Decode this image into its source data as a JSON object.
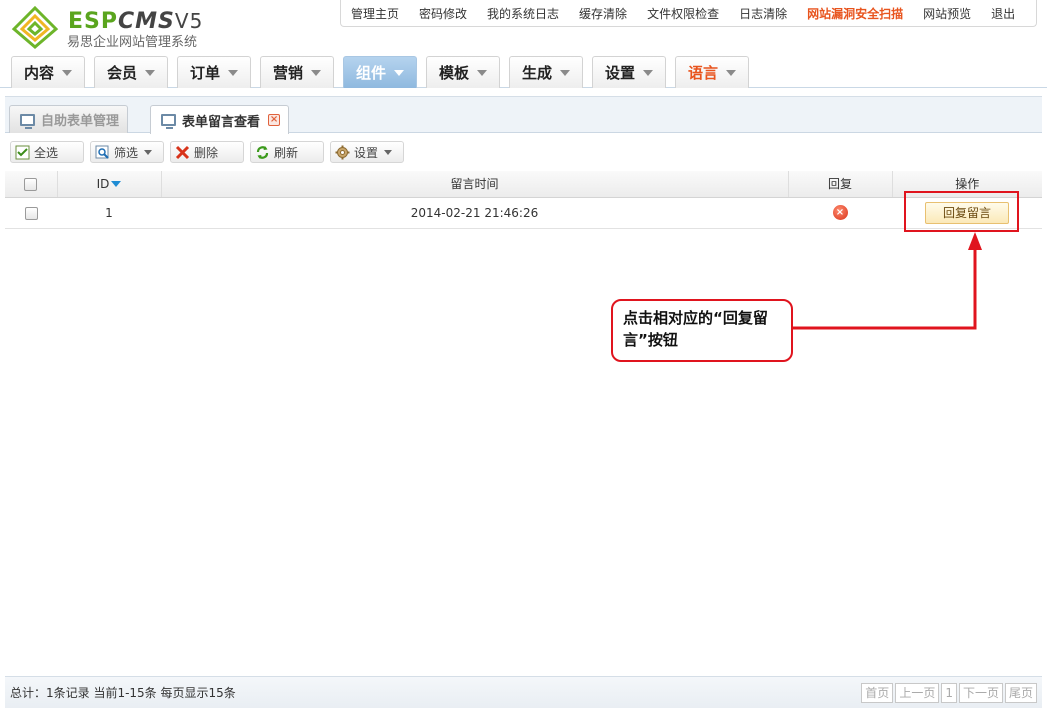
{
  "header": {
    "logo_main": "ESP",
    "logo_cms": "CMS",
    "logo_ver": "V5",
    "logo_sub": "易思企业网站管理系统",
    "top_links": [
      "管理主页",
      "密码修改",
      "我的系统日志",
      "缓存清除",
      "文件权限检查",
      "日志清除",
      "网站漏洞安全扫描",
      "网站预览",
      "退出"
    ]
  },
  "main_nav": [
    "内容",
    "会员",
    "订单",
    "营销",
    "组件",
    "模板",
    "生成",
    "设置",
    "语言"
  ],
  "sub_tabs": {
    "tab1": "自助表单管理",
    "tab2": "表单留言查看",
    "close_glyph": "×"
  },
  "toolbar": {
    "select_all": "全选",
    "filter": "筛选",
    "delete": "删除",
    "refresh": "刷新",
    "settings": "设置"
  },
  "table": {
    "headers": {
      "id": "ID",
      "time": "留言时间",
      "reply": "回复",
      "action": "操作"
    },
    "rows": [
      {
        "id": "1",
        "time": "2014-02-21 21:46:26",
        "reply_status": "×",
        "action_label": "回复留言"
      }
    ]
  },
  "annotation": {
    "callout_text": "点击相对应的“回复留言”按钮",
    "color": "#e0141e"
  },
  "footer": {
    "summary": "总计：1条记录 当前1-15条 每页显示15条",
    "pager": [
      "首页",
      "上一页",
      "1",
      "下一页",
      "尾页"
    ]
  },
  "colors": {
    "accent": "#5aa51e",
    "active_tab": "#9ec4e7",
    "alert": "#e8541e"
  }
}
